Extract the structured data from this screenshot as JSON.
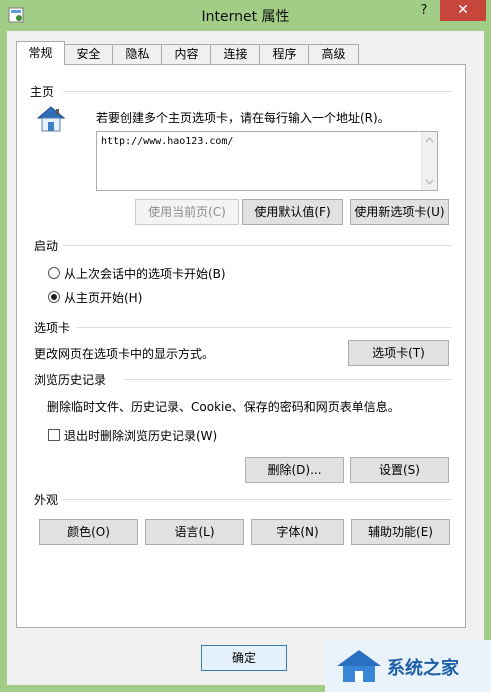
{
  "window": {
    "title": "Internet 属性",
    "help": "?",
    "close": "✕"
  },
  "tabs": [
    {
      "label": "常规",
      "active": true
    },
    {
      "label": "安全"
    },
    {
      "label": "隐私"
    },
    {
      "label": "内容"
    },
    {
      "label": "连接"
    },
    {
      "label": "程序"
    },
    {
      "label": "高级"
    }
  ],
  "home": {
    "section": "主页",
    "instruction": "若要创建多个主页选项卡，请在每行输入一个地址(R)。",
    "url": "http://www.hao123.com/",
    "btn_current": "使用当前页(C)",
    "btn_default": "使用默认值(F)",
    "btn_newtab": "使用新选项卡(U)"
  },
  "startup": {
    "section": "启动",
    "option_last": "从上次会话中的选项卡开始(B)",
    "option_home": "从主页开始(H)",
    "selected": "home"
  },
  "tabs_section": {
    "section": "选项卡",
    "description": "更改网页在选项卡中的显示方式。",
    "btn": "选项卡(T)"
  },
  "history": {
    "section": "浏览历史记录",
    "description": "删除临时文件、历史记录、Cookie、保存的密码和网页表单信息。",
    "checkbox": "退出时删除浏览历史记录(W)",
    "checked": false,
    "btn_delete": "删除(D)...",
    "btn_settings": "设置(S)"
  },
  "appearance": {
    "section": "外观",
    "btn_colors": "颜色(O)",
    "btn_languages": "语言(L)",
    "btn_fonts": "字体(N)",
    "btn_accessibility": "辅助功能(E)"
  },
  "footer": {
    "ok": "确定"
  },
  "watermark": {
    "text": "系统之家"
  },
  "colors": {
    "frame": "#a2cd86",
    "close": "#c7463c"
  }
}
